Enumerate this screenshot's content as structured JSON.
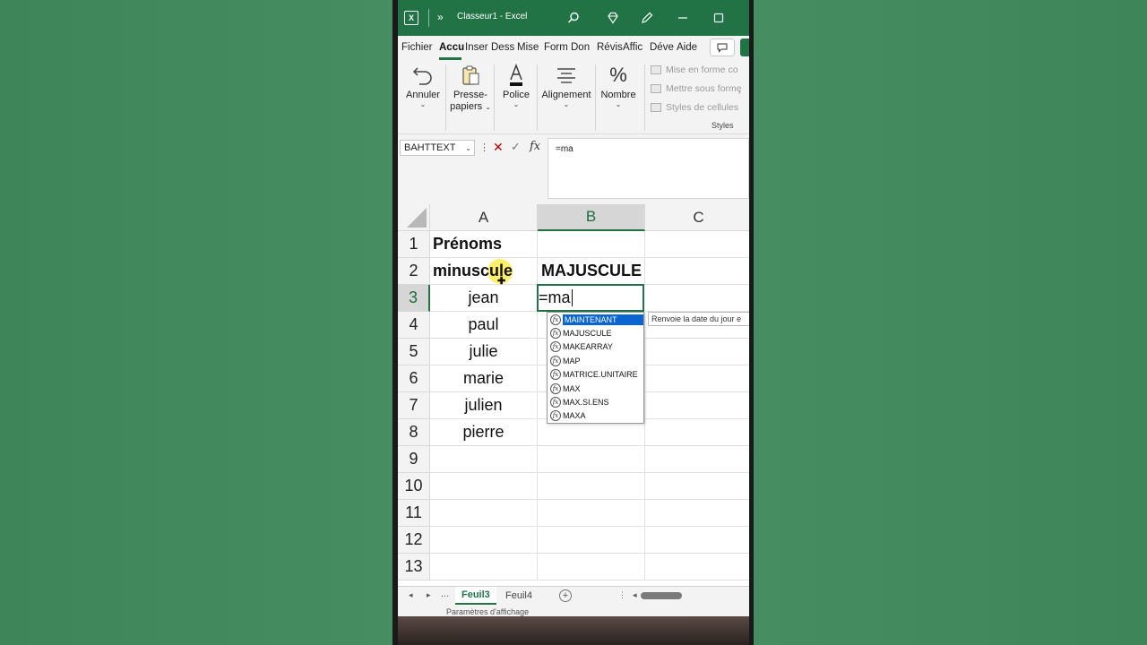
{
  "window": {
    "title": "Classeur1  -  Excel"
  },
  "tabs": [
    "Fichier",
    "Accu",
    "Inser",
    "Dess",
    "Mise",
    "Form",
    "Don",
    "Révis",
    "Affic",
    "Déve",
    "Aide"
  ],
  "ribbon": {
    "annuler": "Annuler",
    "presse_line1": "Presse-",
    "presse_line2": "papiers",
    "police": "Police",
    "alignement": "Alignement",
    "nombre": "Nombre",
    "styles_items": [
      "Mise en forme co",
      "Mettre sous forme",
      "Styles de cellules"
    ],
    "styles_label": "Styles"
  },
  "formula_bar": {
    "name_box": "BAHTTEXT",
    "content": "=ma"
  },
  "columns": [
    "A",
    "B",
    "C"
  ],
  "rows": [
    "1",
    "2",
    "3",
    "4",
    "5",
    "6",
    "7",
    "8",
    "9",
    "10",
    "11",
    "12",
    "13"
  ],
  "cells": {
    "a1": "Prénoms",
    "a2": "minuscule",
    "b2": "MAJUSCULE",
    "a3": "jean",
    "a4": "paul",
    "a5": "julie",
    "a6": "marie",
    "a7": "julien",
    "a8": "pierre",
    "b3_editing": "=ma"
  },
  "autocomplete": {
    "items": [
      "MAINTENANT",
      "MAJUSCULE",
      "MAKEARRAY",
      "MAP",
      "MATRICE.UNITAIRE",
      "MAX",
      "MAX.SI.ENS",
      "MAXA"
    ],
    "selected_index": 0,
    "tooltip": "Renvoie la date du jour e"
  },
  "sheets": {
    "more": "...",
    "active": "Feuil3",
    "other": "Feuil4"
  },
  "status": {
    "display_settings": "Paramètres d'affichage"
  },
  "colors": {
    "excel_green": "#217346",
    "background_green": "#41885d",
    "selection_blue": "#0a64d2"
  }
}
